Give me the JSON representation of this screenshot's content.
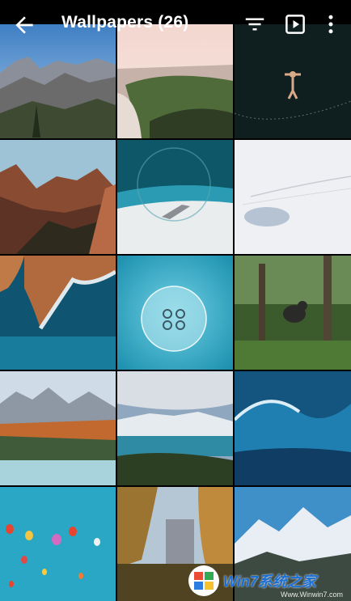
{
  "header": {
    "title": "Wallpapers (26)",
    "back_icon": "arrow-back-icon",
    "actions": [
      "filter-icon",
      "slideshow-icon",
      "more-vert-icon"
    ]
  },
  "grid": {
    "tiles": [
      {
        "subject": "valley-mountains"
      },
      {
        "subject": "coast-cliff"
      },
      {
        "subject": "swimmer-dark-water"
      },
      {
        "subject": "canyon"
      },
      {
        "subject": "shipwreck-beach"
      },
      {
        "subject": "snow-field"
      },
      {
        "subject": "aerial-coast"
      },
      {
        "subject": "jellyfish"
      },
      {
        "subject": "gorilla-forest"
      },
      {
        "subject": "autumn-mountains"
      },
      {
        "subject": "lake-mountains"
      },
      {
        "subject": "ocean-wave"
      },
      {
        "subject": "balloons"
      },
      {
        "subject": "yosemite-forest"
      },
      {
        "subject": "snowy-peaks"
      }
    ]
  },
  "watermark": {
    "main": "Win7系统之家",
    "sub": "Www.Winwin7.com"
  },
  "colors": {
    "background": "#000000",
    "text": "#ffffff",
    "watermark": "#1b6fd3"
  }
}
